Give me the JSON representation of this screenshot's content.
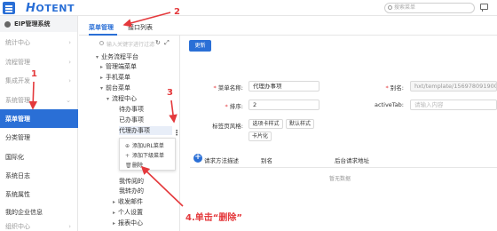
{
  "header": {
    "logo": "OTENT",
    "logo_initial": "H",
    "search_placeholder": "搜索菜单"
  },
  "sidebar": {
    "title": "EIP管理系统",
    "groups": [
      {
        "label": "统计中心"
      },
      {
        "label": "流程管理"
      },
      {
        "label": "集成开发"
      },
      {
        "label": "系统管理"
      }
    ],
    "items": [
      {
        "label": "菜单管理",
        "active": true
      },
      {
        "label": "分类管理"
      },
      {
        "label": "国际化"
      },
      {
        "label": "系统日志"
      },
      {
        "label": "系统属性"
      },
      {
        "label": "我的企业信息"
      },
      {
        "label": "组织中心"
      }
    ]
  },
  "tabs": [
    {
      "label": "菜单管理",
      "active": true
    },
    {
      "label": "接口列表"
    }
  ],
  "tree": {
    "search_placeholder": "输入关键字进行过滤",
    "nodes": [
      {
        "label": "业务流程平台",
        "level": 0,
        "open": true
      },
      {
        "label": "管理端菜单",
        "level": 1
      },
      {
        "label": "手机菜单",
        "level": 1
      },
      {
        "label": "前台菜单",
        "level": 1,
        "open": true
      },
      {
        "label": "流程中心",
        "level": 2,
        "open": true
      },
      {
        "label": "待办事项",
        "level": 3
      },
      {
        "label": "已办事项",
        "level": 3
      },
      {
        "label": "代理办事项",
        "level": 3,
        "selected": true
      },
      {
        "label": "我传阅的",
        "level": 3
      },
      {
        "label": "我转办的",
        "level": 3
      },
      {
        "label": "收发邮件",
        "level": 2
      },
      {
        "label": "个人设置",
        "level": 2
      },
      {
        "label": "报表中心",
        "level": 2
      }
    ],
    "context_menu": [
      {
        "icon": "circle-plus-icon",
        "label": "添加URL菜单"
      },
      {
        "icon": "plus-icon",
        "label": "添加下级菜单"
      },
      {
        "icon": "trash-icon",
        "label": "删除"
      }
    ]
  },
  "form": {
    "update_label": "更新",
    "name_label": "菜单名称:",
    "name_value": "代理办事项",
    "alias_label": "别名:",
    "alias_value": "hxt/template/1569780919000_4",
    "sort_label": "排序:",
    "sort_value": "2",
    "active_tab_label": "activeTab:",
    "active_tab_placeholder": "请输入内容",
    "style_label": "标签页风格:",
    "styles": [
      "选项卡样式",
      "默认样式",
      "卡片化"
    ],
    "table_headers": [
      "请求方法描述",
      "别名",
      "后台请求地址"
    ],
    "empty_text": "暂无数据"
  },
  "annotations": {
    "n1": "1",
    "n2": "2",
    "n3": "3",
    "step4": "4.单击“删除”",
    "color": "#e4393c"
  }
}
